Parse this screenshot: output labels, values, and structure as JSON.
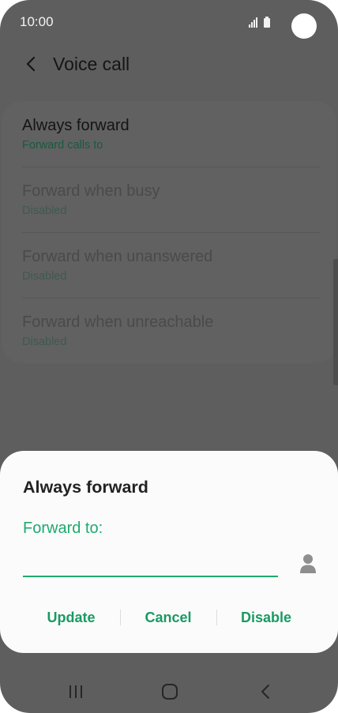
{
  "status_bar": {
    "time": "10:00",
    "icons": [
      "signal-icon",
      "battery-icon"
    ]
  },
  "header": {
    "back_icon": "chevron-left-icon",
    "title": "Voice call"
  },
  "settings": {
    "items": [
      {
        "title": "Always forward",
        "subtitle": "Forward calls to",
        "enabled": true
      },
      {
        "title": "Forward when busy",
        "subtitle": "Disabled",
        "enabled": false
      },
      {
        "title": "Forward when unanswered",
        "subtitle": "Disabled",
        "enabled": false
      },
      {
        "title": "Forward when unreachable",
        "subtitle": "Disabled",
        "enabled": false
      }
    ]
  },
  "dialog": {
    "title": "Always forward",
    "field_label": "Forward to:",
    "input_value": "",
    "contact_icon": "contact-icon",
    "buttons": {
      "update": "Update",
      "cancel": "Cancel",
      "disable": "Disable"
    }
  },
  "nav_bar": {
    "icons": [
      "recent-apps-icon",
      "home-icon",
      "back-icon"
    ]
  },
  "colors": {
    "accent": "#1eaa6f",
    "dim_background": "#5e5e5e",
    "dialog_background": "#fbfbfb"
  }
}
